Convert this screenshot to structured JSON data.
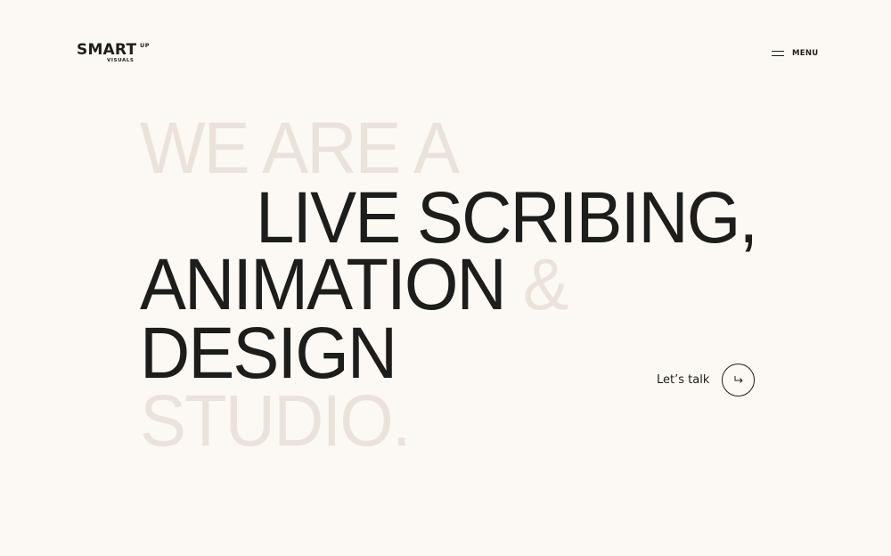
{
  "logo": {
    "main": "SMART",
    "superscript": "UP",
    "sub": "VISUALS"
  },
  "nav": {
    "menu_label": "MENU",
    "menu_icon": "hamburger-icon"
  },
  "hero": {
    "line1": "WE ARE A",
    "line2": "LIVE SCRIBING,",
    "line3_dark": "ANIMATION",
    "line3_light": "&",
    "line4": "DESIGN",
    "line5": "STUDIO."
  },
  "cta": {
    "label": "Let’s talk",
    "icon": "arrow-return-right-icon"
  },
  "colors": {
    "background": "#fcf9f4",
    "text_dark": "#1d1d1b",
    "text_light": "#ebe2dc"
  }
}
